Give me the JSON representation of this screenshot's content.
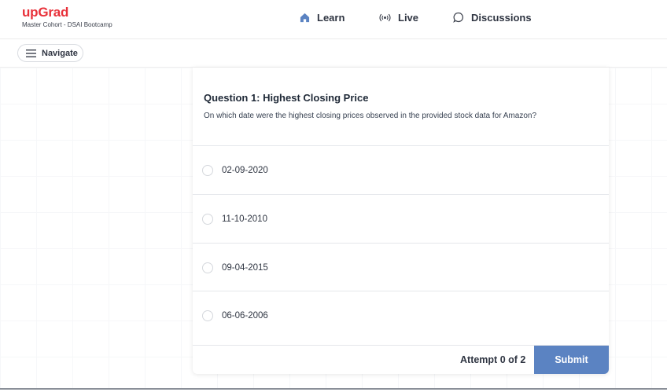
{
  "brand": {
    "name": "upGrad",
    "subtitle": "Master Cohort - DSAI Bootcamp",
    "color": "#e8313a"
  },
  "nav": {
    "learn": {
      "label": "Learn",
      "icon": "home-icon",
      "icon_color": "#5b83c2"
    },
    "live": {
      "label": "Live",
      "icon": "broadcast-icon"
    },
    "discussions": {
      "label": "Discussions",
      "icon": "chat-bubble-icon"
    }
  },
  "toolbar": {
    "navigate_label": "Navigate",
    "navigate_icon": "hamburger-menu-icon"
  },
  "question": {
    "title": "Question 1: Highest Closing Price",
    "text": "On which date were the highest closing prices observed in the provided stock data for Amazon?",
    "options": [
      {
        "label": "02-09-2020",
        "selected": false
      },
      {
        "label": "11-10-2010",
        "selected": false
      },
      {
        "label": "09-04-2015",
        "selected": false
      },
      {
        "label": "06-06-2006",
        "selected": false
      }
    ]
  },
  "footer": {
    "attempt_text": "Attempt 0 of 2",
    "submit_label": "Submit",
    "submit_color": "#5b83c2"
  }
}
